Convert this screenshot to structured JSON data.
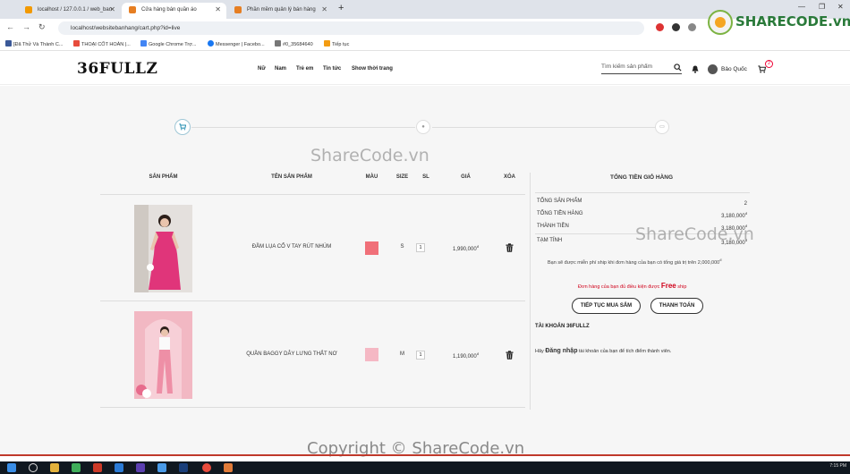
{
  "browser": {
    "tabs": [
      {
        "label": "localhost / 127.0.0.1 / web_ban",
        "color": "#f29900"
      },
      {
        "label": "Cửa hàng bán quần áo",
        "color": "#e67e22"
      },
      {
        "label": "Phần mềm quản lý bán hàng",
        "color": "#e67e22"
      }
    ],
    "url": "localhost/websitebanhang/cart.php?id=live",
    "bookmarks": [
      "[Đã Thử Và Thành C...",
      "THOẠI CỐT HOÀN |...",
      "Google Chrome Trợ...",
      "Messenger | Facebo...",
      "#0_35684640",
      "Tiếp tục"
    ]
  },
  "header": {
    "logo": "36FULLZ",
    "nav": [
      "Nữ",
      "Nam",
      "Trẻ em",
      "Tin tức",
      "Show thời trang"
    ],
    "search_placeholder": "Tìm kiếm sản phẩm",
    "username": "Bảo Quốc",
    "cart_count": "2"
  },
  "cart": {
    "headers": [
      "SẢN PHẨM",
      "TÊN SẢN PHẨM",
      "MÀU",
      "SIZE",
      "SL",
      "GIÁ",
      "XÓA"
    ],
    "items": [
      {
        "name": "ĐẦM LỤA CỔ V TAY RÚT NHÚM",
        "color": "#f07079",
        "size": "S",
        "qty": "1",
        "price": "1,990,000",
        "currency": "đ"
      },
      {
        "name": "QUẦN BAGGY DÂY LƯNG THẮT NƠ",
        "color": "#f5b8c4",
        "size": "M",
        "qty": "1",
        "price": "1,190,000",
        "currency": "đ"
      }
    ]
  },
  "summary": {
    "title": "TỔNG TIỀN GIỎ HÀNG",
    "rows": [
      {
        "label": "TỔNG SẢN PHẨM",
        "value": "2",
        "currency": ""
      },
      {
        "label": "TỔNG TIỀN HÀNG",
        "value": "3,180,000",
        "currency": "đ"
      },
      {
        "label": "THÀNH TIỀN",
        "value": "3,180,000",
        "currency": "đ"
      },
      {
        "label": "TẠM TÍNH",
        "value": "3,180,000",
        "currency": "đ"
      }
    ],
    "ship_note": "Bạn sẽ được miễn phí ship khi đơn hàng của bạn có tổng giá trị trên 2,000,000",
    "ship_note_currency": "đ",
    "eligible_prefix": "Đơn hàng của bạn đủ điều kiện được",
    "eligible_free": "Free",
    "eligible_suffix": "ship",
    "continue_button": "TIẾP TỤC MUA SẮM",
    "checkout_button": "THANH TOÁN",
    "account_title": "TÀI KHOẢN 36FULLZ",
    "account_prefix": "Hãy",
    "account_login": "Đăng nhập",
    "account_suffix": "tài khoản của bạn để tích điểm thành viên."
  },
  "watermarks": {
    "main": "ShareCode.vn",
    "copyright": "Copyright © ShareCode.vn",
    "logo": "SHARECODE.vn"
  },
  "taskbar": {
    "time": "7:15 PM"
  }
}
